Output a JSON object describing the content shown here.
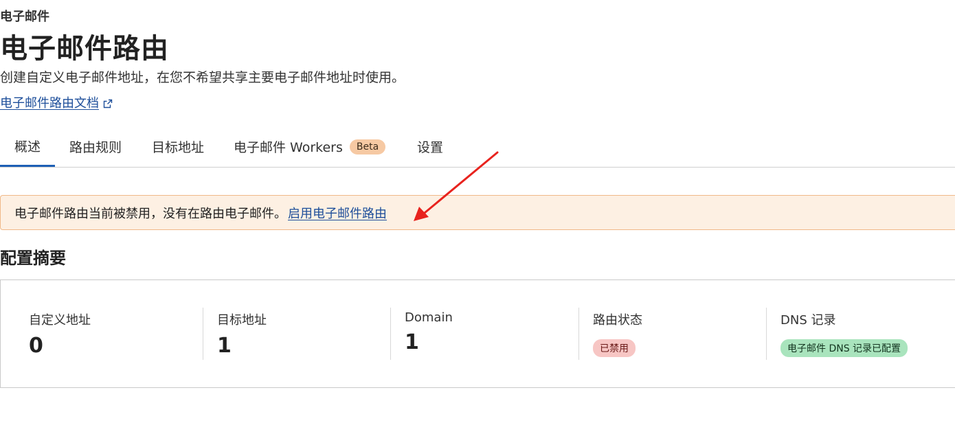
{
  "breadcrumb": "电子邮件",
  "title": "电子邮件路由",
  "description": "创建自定义电子邮件地址，在您不希望共享主要电子邮件地址时使用。",
  "doc_link": {
    "label": "电子邮件路由文档",
    "icon": "external-link-icon"
  },
  "tabs": [
    {
      "label": "概述",
      "active": true
    },
    {
      "label": "路由规则"
    },
    {
      "label": "目标地址"
    },
    {
      "label": "电子邮件 Workers",
      "badge": "Beta"
    },
    {
      "label": "设置"
    }
  ],
  "notice": {
    "text": "电子邮件路由当前被禁用，没有在路由电子邮件。",
    "link": "启用电子邮件路由"
  },
  "summary": {
    "title": "配置摘要",
    "stats": [
      {
        "label": "自定义地址",
        "value": "0"
      },
      {
        "label": "目标地址",
        "value": "1"
      },
      {
        "label": "Domain",
        "value": "1"
      },
      {
        "label": "路由状态",
        "badge": "已禁用"
      },
      {
        "label": "DNS 记录",
        "badge": "电子邮件 DNS 记录已配置"
      }
    ]
  },
  "colors": {
    "link": "#1d4e9a",
    "active_tab": "#1d5fb5",
    "notice_bg": "#fdf0e3",
    "notice_border": "#f0b888",
    "badge_beta": "#f6c9a3",
    "badge_disabled": "#f7c6c4",
    "badge_configured": "#a9e4bd",
    "annotation_arrow": "#e8231e"
  }
}
